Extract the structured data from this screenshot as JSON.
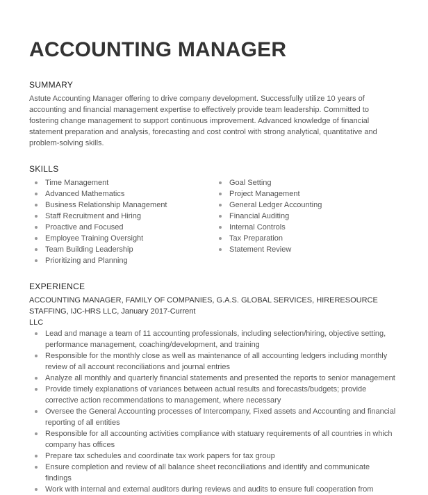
{
  "title": "ACCOUNTING MANAGER",
  "summary": {
    "heading": "SUMMARY",
    "text": "Astute Accounting Manager offering to drive company development. Successfully utilize 10 years of accounting and financial management expertise to effectively provide team leadership. Committed to fostering change management to support continuous improvement. Advanced knowledge of financial statement preparation and analysis, forecasting and cost control with strong analytical, quantitative and problem-solving skills."
  },
  "skills": {
    "heading": "SKILLS",
    "left": [
      "Time Management",
      "Advanced Mathematics",
      "Business Relationship Management",
      "Staff Recruitment and Hiring",
      "Proactive and Focused",
      "Employee Training Oversight",
      "Team Building Leadership",
      "Prioritizing and Planning"
    ],
    "right": [
      "Goal Setting",
      "Project Management",
      "General Ledger Accounting",
      "Financial Auditing",
      "Internal Controls",
      "Tax Preparation",
      "Statement Review"
    ]
  },
  "experience": {
    "heading": "EXPERIENCE",
    "job_title": "ACCOUNTING MANAGER, FAMILY OF COMPANIES, G.A.S. GLOBAL SERVICES, HIRERESOURCE STAFFING, IJC-HRS LLC, January 2017-Current",
    "job_sub": "LLC",
    "bullets": [
      "Lead and manage a team of 11 accounting professionals, including selection/hiring, objective setting, performance management, coaching/development, and training",
      "Responsible for the monthly close as well as maintenance of all accounting ledgers including monthly review of all account reconciliations and journal entries",
      "Analyze all monthly and quarterly financial statements and presented the reports to senior management",
      "Provide timely explanations of variances between actual results and forecasts/budgets; provide corrective action recommendations to management, where necessary",
      "Oversee the General Accounting processes of Intercompany, Fixed assets and Accounting and financial reporting of all entities",
      "Responsible for all accounting activities compliance with statuary requirements of all countries in which company has offices",
      "Prepare tax schedules and coordinate tax work papers for tax group",
      "Ensure completion and review of all balance sheet reconciliations and identify and communicate findings",
      "Work with internal and external auditors during reviews and audits to ensure full cooperation from"
    ]
  }
}
